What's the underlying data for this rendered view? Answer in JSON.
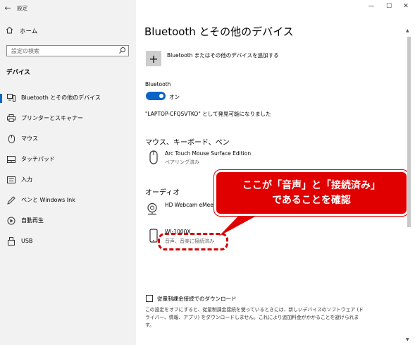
{
  "window": {
    "title": "設定",
    "back_icon": "back-arrow-icon",
    "controls": {
      "minimize": "—",
      "maximize": "☐",
      "close": "✕"
    }
  },
  "sidebar": {
    "home_label": "ホーム",
    "search_placeholder": "設定の検索",
    "section_heading": "デバイス",
    "items": [
      {
        "label": "Bluetooth とその他のデバイス",
        "icon": "bluetooth-devices-icon",
        "active": true
      },
      {
        "label": "プリンターとスキャナー",
        "icon": "printer-icon",
        "active": false
      },
      {
        "label": "マウス",
        "icon": "mouse-icon",
        "active": false
      },
      {
        "label": "タッチパッド",
        "icon": "touchpad-icon",
        "active": false
      },
      {
        "label": "入力",
        "icon": "keyboard-icon",
        "active": false
      },
      {
        "label": "ペンと Windows Ink",
        "icon": "pen-icon",
        "active": false
      },
      {
        "label": "自動再生",
        "icon": "autoplay-icon",
        "active": false
      },
      {
        "label": "USB",
        "icon": "usb-icon",
        "active": false
      }
    ]
  },
  "main": {
    "page_title": "Bluetooth とその他のデバイス",
    "add_device_label": "Bluetooth またはその他のデバイスを追加する",
    "bluetooth_label": "Bluetooth",
    "bluetooth_state": "オン",
    "discoverable_text": "\"LAPTOP-CFQSVTKO\" として発見可能になりました",
    "mouse_group": {
      "heading": "マウス、キーボード、ペン",
      "devices": [
        {
          "name": "Arc Touch Mouse Surface Edition",
          "status": "ペアリング済み",
          "icon": "mouse-icon"
        }
      ]
    },
    "audio_group": {
      "heading": "オーディオ",
      "devices": [
        {
          "name": "HD Webcam eMeet",
          "status": "",
          "icon": "webcam-icon"
        },
        {
          "name": "WI-1000X",
          "status": "音声、音楽に接続済み",
          "icon": "phone-device-icon"
        }
      ]
    },
    "metered_checkbox_label": "従量制課金接続でのダウンロード",
    "metered_checked": false,
    "metered_note": "この設定をオフにすると、従量制課金接続を使っているときには、新しいデバイスのソフトウェア (ドライバー、情報、アプリ) をダウンロードしません。これにより追加料金がかかることを避けられます。"
  },
  "callout": {
    "line1": "ここが「音声」と「接続済み」",
    "line2": "であることを確認",
    "color": "#e00000"
  },
  "colors": {
    "accent": "#0a64c8",
    "sidebar_bg": "#f2f2f2"
  }
}
